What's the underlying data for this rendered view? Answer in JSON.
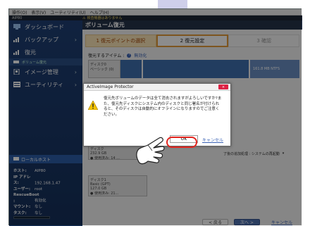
{
  "menubar": {
    "items": [
      "操作(O)",
      "表示(V)",
      "ユーティリティ(U)",
      "ヘルプ(H)"
    ]
  },
  "titlebar": {
    "app": "AIP80",
    "notice": "検査機器はありません"
  },
  "sidebar": {
    "items": [
      {
        "label": "ダッシュボード",
        "icon": "dashboard-icon"
      },
      {
        "label": "バックアップ",
        "icon": "backup-icon",
        "chevron": "›"
      },
      {
        "label": "復元",
        "icon": "restore-icon"
      },
      {
        "label": "イメージ管理",
        "icon": "image-manage-icon",
        "chevron": "›"
      },
      {
        "label": "ユーティリティ",
        "icon": "utility-icon",
        "chevron": "›"
      }
    ],
    "subitem": "ボリューム復元",
    "localhost": "ローカルホスト",
    "hostinfo": [
      {
        "k": "ホスト:",
        "v": "AIP80"
      },
      {
        "k": "IP アドレス:",
        "v": "192.168.1.47"
      },
      {
        "k": "ユーザー:",
        "v": "root"
      },
      {
        "k": "RescueBoot :",
        "v": "有効化"
      },
      {
        "k": "マウント:",
        "v": "なし"
      },
      {
        "k": "タスク:",
        "v": "なし"
      }
    ]
  },
  "main": {
    "title": "ボリューム復元",
    "steps": [
      {
        "label": "1  復元ポイントの選択"
      },
      {
        "label": "2  復元設定"
      },
      {
        "label": "3  確認"
      }
    ],
    "restore_target_label": "復元するアイテム :",
    "restore_target_link": "無効化",
    "disk1": {
      "name": "ディスク0",
      "sub": "ベーシック (0)",
      "partition": "161.8 MB NTFS"
    },
    "disk2": {
      "name": "ディスク",
      "sub": "232.9 GB",
      "sub2": "● 使用済み: 14 ..."
    },
    "disk3": {
      "name": "ディスク1",
      "sub": "Basic (GPT)",
      "sub2": "127.0 GB",
      "sub3": "● 使用済み: 21..."
    },
    "filter_text": "了後の追加処理 : システムの再起動",
    "back_button": "< 戻る",
    "next_button": "次へ >",
    "cancel_button": "キャンセル"
  },
  "dialog": {
    "title": "ActiveImage Protector",
    "close": "×",
    "message": "復元先ボリュームのデータは全て消去されますがよろしいですか?また、復元先ディスクにシステム内のディスクと同じ署名が付けられると、そのディスクは自動的にオフラインになりますのでご注意ください。",
    "ok": "OK",
    "cancel": "キャンセル"
  },
  "colors": {
    "sidebar": "#1f3f74",
    "accent": "#e49b3a",
    "highlight": "#e2251e",
    "link": "#3b63b5"
  }
}
